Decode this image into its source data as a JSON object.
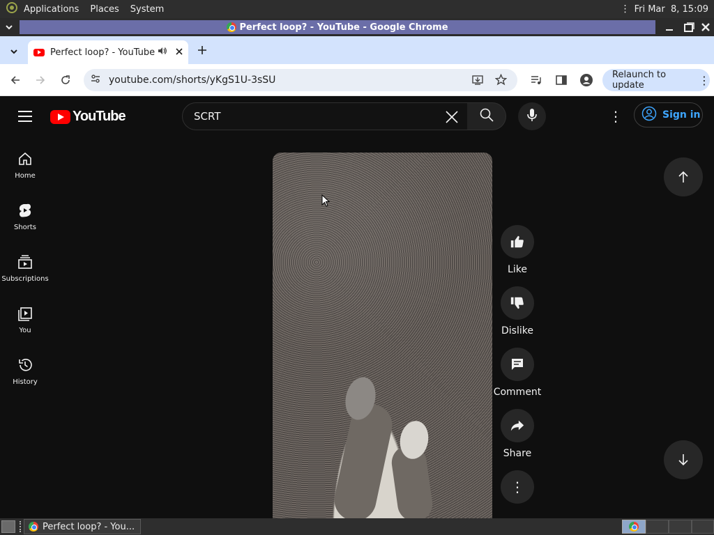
{
  "panel": {
    "menus": [
      "Applications",
      "Places",
      "System"
    ],
    "clock": "Fri Mar  8, 15:09"
  },
  "window": {
    "title": "Perfect loop? - YouTube - Google Chrome"
  },
  "tab": {
    "title": "Perfect loop? - YouTube"
  },
  "toolbar": {
    "url": "youtube.com/shorts/yKgS1U-3sSU",
    "relaunch_label": "Relaunch to update"
  },
  "youtube": {
    "logo_text": "YouTube",
    "search_value": "SCRT",
    "signin_label": "Sign in",
    "guide": [
      {
        "label": "Home"
      },
      {
        "label": "Shorts"
      },
      {
        "label": "Subscriptions"
      },
      {
        "label": "You"
      },
      {
        "label": "History"
      }
    ],
    "actions": {
      "like": "Like",
      "dislike": "Dislike",
      "comment": "Comment",
      "share": "Share"
    }
  },
  "taskbar": {
    "window_label": "Perfect loop? - You..."
  },
  "colors": {
    "youtube_red": "#ff0000",
    "signin_blue": "#3ea6ff",
    "tabstrip": "#d3e3fd",
    "title_band": "#6b6ea8"
  }
}
